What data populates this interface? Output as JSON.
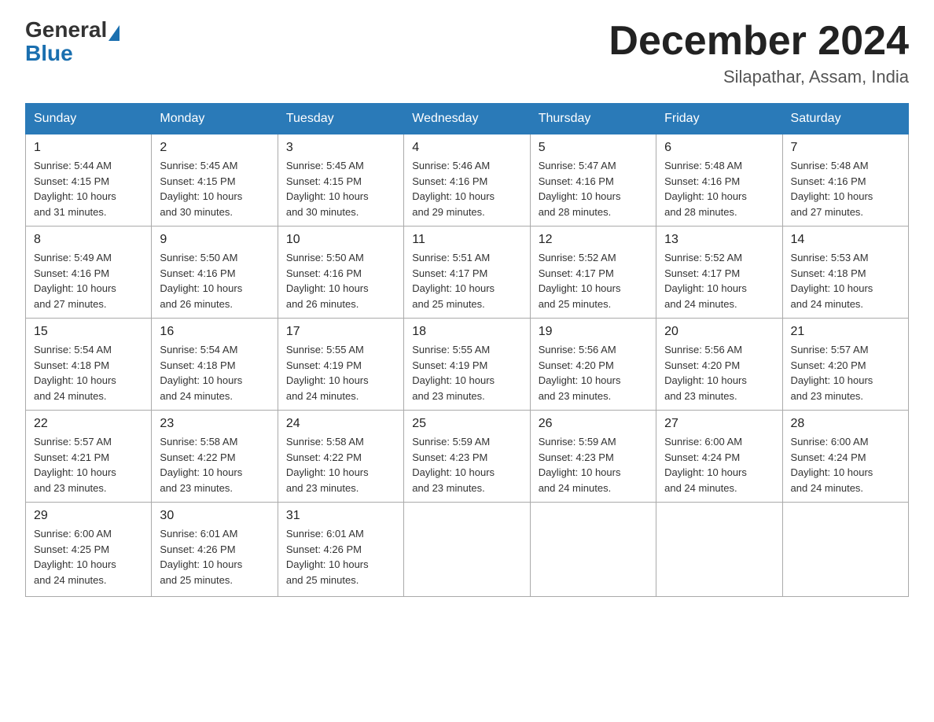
{
  "header": {
    "logo_general": "General",
    "logo_blue": "Blue",
    "title": "December 2024",
    "subtitle": "Silapathar, Assam, India"
  },
  "days_of_week": [
    "Sunday",
    "Monday",
    "Tuesday",
    "Wednesday",
    "Thursday",
    "Friday",
    "Saturday"
  ],
  "weeks": [
    [
      {
        "num": "1",
        "sunrise": "5:44 AM",
        "sunset": "4:15 PM",
        "daylight": "10 hours and 31 minutes."
      },
      {
        "num": "2",
        "sunrise": "5:45 AM",
        "sunset": "4:15 PM",
        "daylight": "10 hours and 30 minutes."
      },
      {
        "num": "3",
        "sunrise": "5:45 AM",
        "sunset": "4:15 PM",
        "daylight": "10 hours and 30 minutes."
      },
      {
        "num": "4",
        "sunrise": "5:46 AM",
        "sunset": "4:16 PM",
        "daylight": "10 hours and 29 minutes."
      },
      {
        "num": "5",
        "sunrise": "5:47 AM",
        "sunset": "4:16 PM",
        "daylight": "10 hours and 28 minutes."
      },
      {
        "num": "6",
        "sunrise": "5:48 AM",
        "sunset": "4:16 PM",
        "daylight": "10 hours and 28 minutes."
      },
      {
        "num": "7",
        "sunrise": "5:48 AM",
        "sunset": "4:16 PM",
        "daylight": "10 hours and 27 minutes."
      }
    ],
    [
      {
        "num": "8",
        "sunrise": "5:49 AM",
        "sunset": "4:16 PM",
        "daylight": "10 hours and 27 minutes."
      },
      {
        "num": "9",
        "sunrise": "5:50 AM",
        "sunset": "4:16 PM",
        "daylight": "10 hours and 26 minutes."
      },
      {
        "num": "10",
        "sunrise": "5:50 AM",
        "sunset": "4:16 PM",
        "daylight": "10 hours and 26 minutes."
      },
      {
        "num": "11",
        "sunrise": "5:51 AM",
        "sunset": "4:17 PM",
        "daylight": "10 hours and 25 minutes."
      },
      {
        "num": "12",
        "sunrise": "5:52 AM",
        "sunset": "4:17 PM",
        "daylight": "10 hours and 25 minutes."
      },
      {
        "num": "13",
        "sunrise": "5:52 AM",
        "sunset": "4:17 PM",
        "daylight": "10 hours and 24 minutes."
      },
      {
        "num": "14",
        "sunrise": "5:53 AM",
        "sunset": "4:18 PM",
        "daylight": "10 hours and 24 minutes."
      }
    ],
    [
      {
        "num": "15",
        "sunrise": "5:54 AM",
        "sunset": "4:18 PM",
        "daylight": "10 hours and 24 minutes."
      },
      {
        "num": "16",
        "sunrise": "5:54 AM",
        "sunset": "4:18 PM",
        "daylight": "10 hours and 24 minutes."
      },
      {
        "num": "17",
        "sunrise": "5:55 AM",
        "sunset": "4:19 PM",
        "daylight": "10 hours and 24 minutes."
      },
      {
        "num": "18",
        "sunrise": "5:55 AM",
        "sunset": "4:19 PM",
        "daylight": "10 hours and 23 minutes."
      },
      {
        "num": "19",
        "sunrise": "5:56 AM",
        "sunset": "4:20 PM",
        "daylight": "10 hours and 23 minutes."
      },
      {
        "num": "20",
        "sunrise": "5:56 AM",
        "sunset": "4:20 PM",
        "daylight": "10 hours and 23 minutes."
      },
      {
        "num": "21",
        "sunrise": "5:57 AM",
        "sunset": "4:20 PM",
        "daylight": "10 hours and 23 minutes."
      }
    ],
    [
      {
        "num": "22",
        "sunrise": "5:57 AM",
        "sunset": "4:21 PM",
        "daylight": "10 hours and 23 minutes."
      },
      {
        "num": "23",
        "sunrise": "5:58 AM",
        "sunset": "4:22 PM",
        "daylight": "10 hours and 23 minutes."
      },
      {
        "num": "24",
        "sunrise": "5:58 AM",
        "sunset": "4:22 PM",
        "daylight": "10 hours and 23 minutes."
      },
      {
        "num": "25",
        "sunrise": "5:59 AM",
        "sunset": "4:23 PM",
        "daylight": "10 hours and 23 minutes."
      },
      {
        "num": "26",
        "sunrise": "5:59 AM",
        "sunset": "4:23 PM",
        "daylight": "10 hours and 24 minutes."
      },
      {
        "num": "27",
        "sunrise": "6:00 AM",
        "sunset": "4:24 PM",
        "daylight": "10 hours and 24 minutes."
      },
      {
        "num": "28",
        "sunrise": "6:00 AM",
        "sunset": "4:24 PM",
        "daylight": "10 hours and 24 minutes."
      }
    ],
    [
      {
        "num": "29",
        "sunrise": "6:00 AM",
        "sunset": "4:25 PM",
        "daylight": "10 hours and 24 minutes."
      },
      {
        "num": "30",
        "sunrise": "6:01 AM",
        "sunset": "4:26 PM",
        "daylight": "10 hours and 25 minutes."
      },
      {
        "num": "31",
        "sunrise": "6:01 AM",
        "sunset": "4:26 PM",
        "daylight": "10 hours and 25 minutes."
      },
      null,
      null,
      null,
      null
    ]
  ],
  "labels": {
    "sunrise": "Sunrise:",
    "sunset": "Sunset:",
    "daylight": "Daylight:"
  }
}
